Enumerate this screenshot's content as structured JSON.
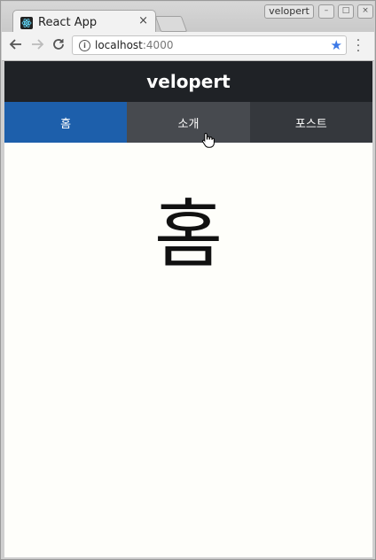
{
  "browser": {
    "tab": {
      "title": "React App",
      "close": "×"
    },
    "profile": {
      "name": "velopert"
    },
    "window_controls": {
      "minimize": "–",
      "maximize": "□",
      "close": "×"
    },
    "address": {
      "host": "localhost",
      "port": ":4000"
    },
    "icons": {
      "back": "arrow-left-icon",
      "forward": "arrow-right-icon",
      "reload": "reload-icon",
      "info": "info-icon",
      "bookmark": "star-icon",
      "menu": "more-vert-icon",
      "favicon": "react-logo-icon"
    },
    "colors": {
      "bookmark_star": "#3b78e7"
    }
  },
  "site": {
    "header": {
      "title": "velopert"
    },
    "nav": {
      "items": [
        {
          "label": "홈",
          "state": "active"
        },
        {
          "label": "소개",
          "state": "hover"
        },
        {
          "label": "포스트",
          "state": "normal"
        }
      ]
    },
    "main": {
      "heading": "홈"
    },
    "colors": {
      "header_bg": "#1f2226",
      "nav_active": "#1d5fab",
      "nav_hover": "#474a4f",
      "nav_normal": "#35383d"
    }
  }
}
